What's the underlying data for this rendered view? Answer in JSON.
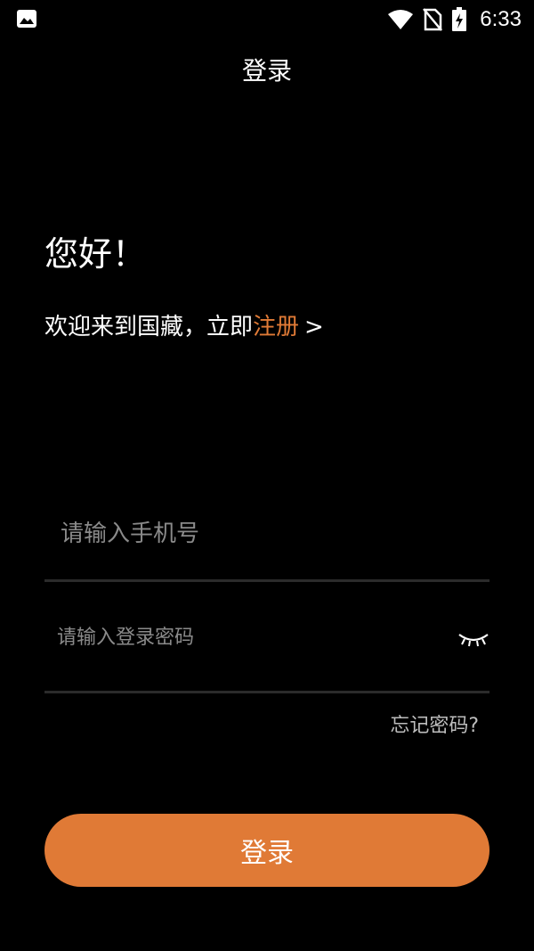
{
  "status_bar": {
    "time": "6:33",
    "icons": [
      "image-icon",
      "wifi-icon",
      "no-sim-icon",
      "battery-charging-icon"
    ]
  },
  "header": {
    "title": "登录"
  },
  "greeting": "您好！",
  "welcome": {
    "text": "欢迎来到国藏，立即",
    "register_link": "注册",
    "chevron": ">"
  },
  "form": {
    "phone_placeholder": "请输入手机号",
    "password_placeholder": "请输入登录密码",
    "forgot_password": "忘记密码?"
  },
  "login_button": "登录",
  "colors": {
    "background": "#000000",
    "accent": "#e07a36",
    "divider": "#2b2b2b",
    "placeholder": "#8a8a8a"
  }
}
